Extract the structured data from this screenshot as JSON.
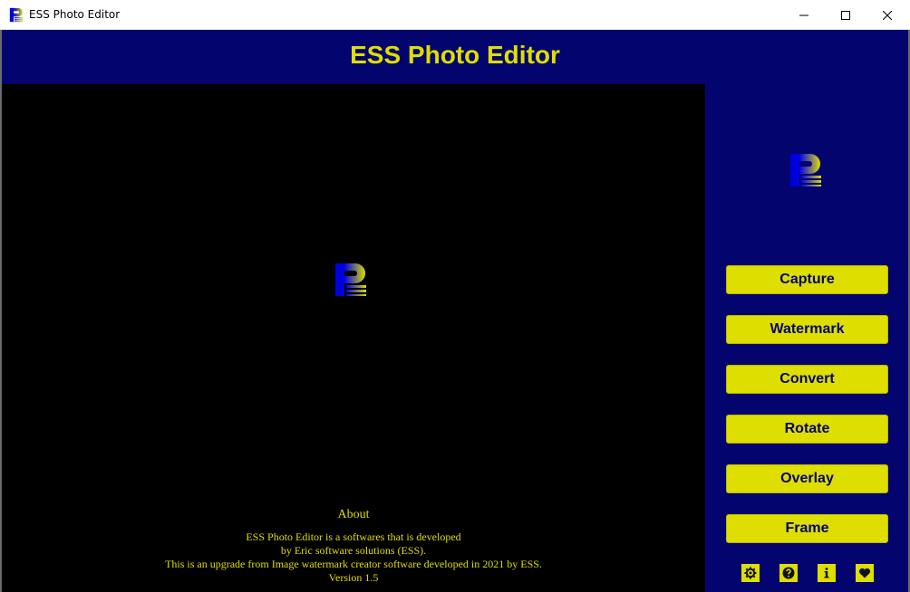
{
  "window": {
    "title": "ESS Photo Editor",
    "icon": "ess-logo-icon",
    "controls": [
      "minimize-icon",
      "maximize-icon",
      "close-icon"
    ]
  },
  "header": {
    "title": "ESS Photo Editor"
  },
  "canvas": {
    "logo_icon": "ess-logo-icon",
    "about": {
      "title": "About",
      "lines": [
        "ESS Photo Editor is a softwares that is developed",
        "by Eric software solutions (ESS).",
        "This is an upgrade from Image watermark creator software developed in 2021 by ESS.",
        "Version 1.5"
      ]
    }
  },
  "sidebar": {
    "logo_icon": "ess-logo-icon",
    "buttons": [
      {
        "label": "Capture"
      },
      {
        "label": "Watermark"
      },
      {
        "label": "Convert"
      },
      {
        "label": "Rotate"
      },
      {
        "label": "Overlay"
      },
      {
        "label": "Frame"
      }
    ],
    "icon_buttons": [
      "settings-icon",
      "help-icon",
      "info-icon",
      "heart-icon"
    ]
  },
  "colors": {
    "brand_navy": "#04046e",
    "accent_yellow": "#dede00",
    "canvas_black": "#000000"
  }
}
